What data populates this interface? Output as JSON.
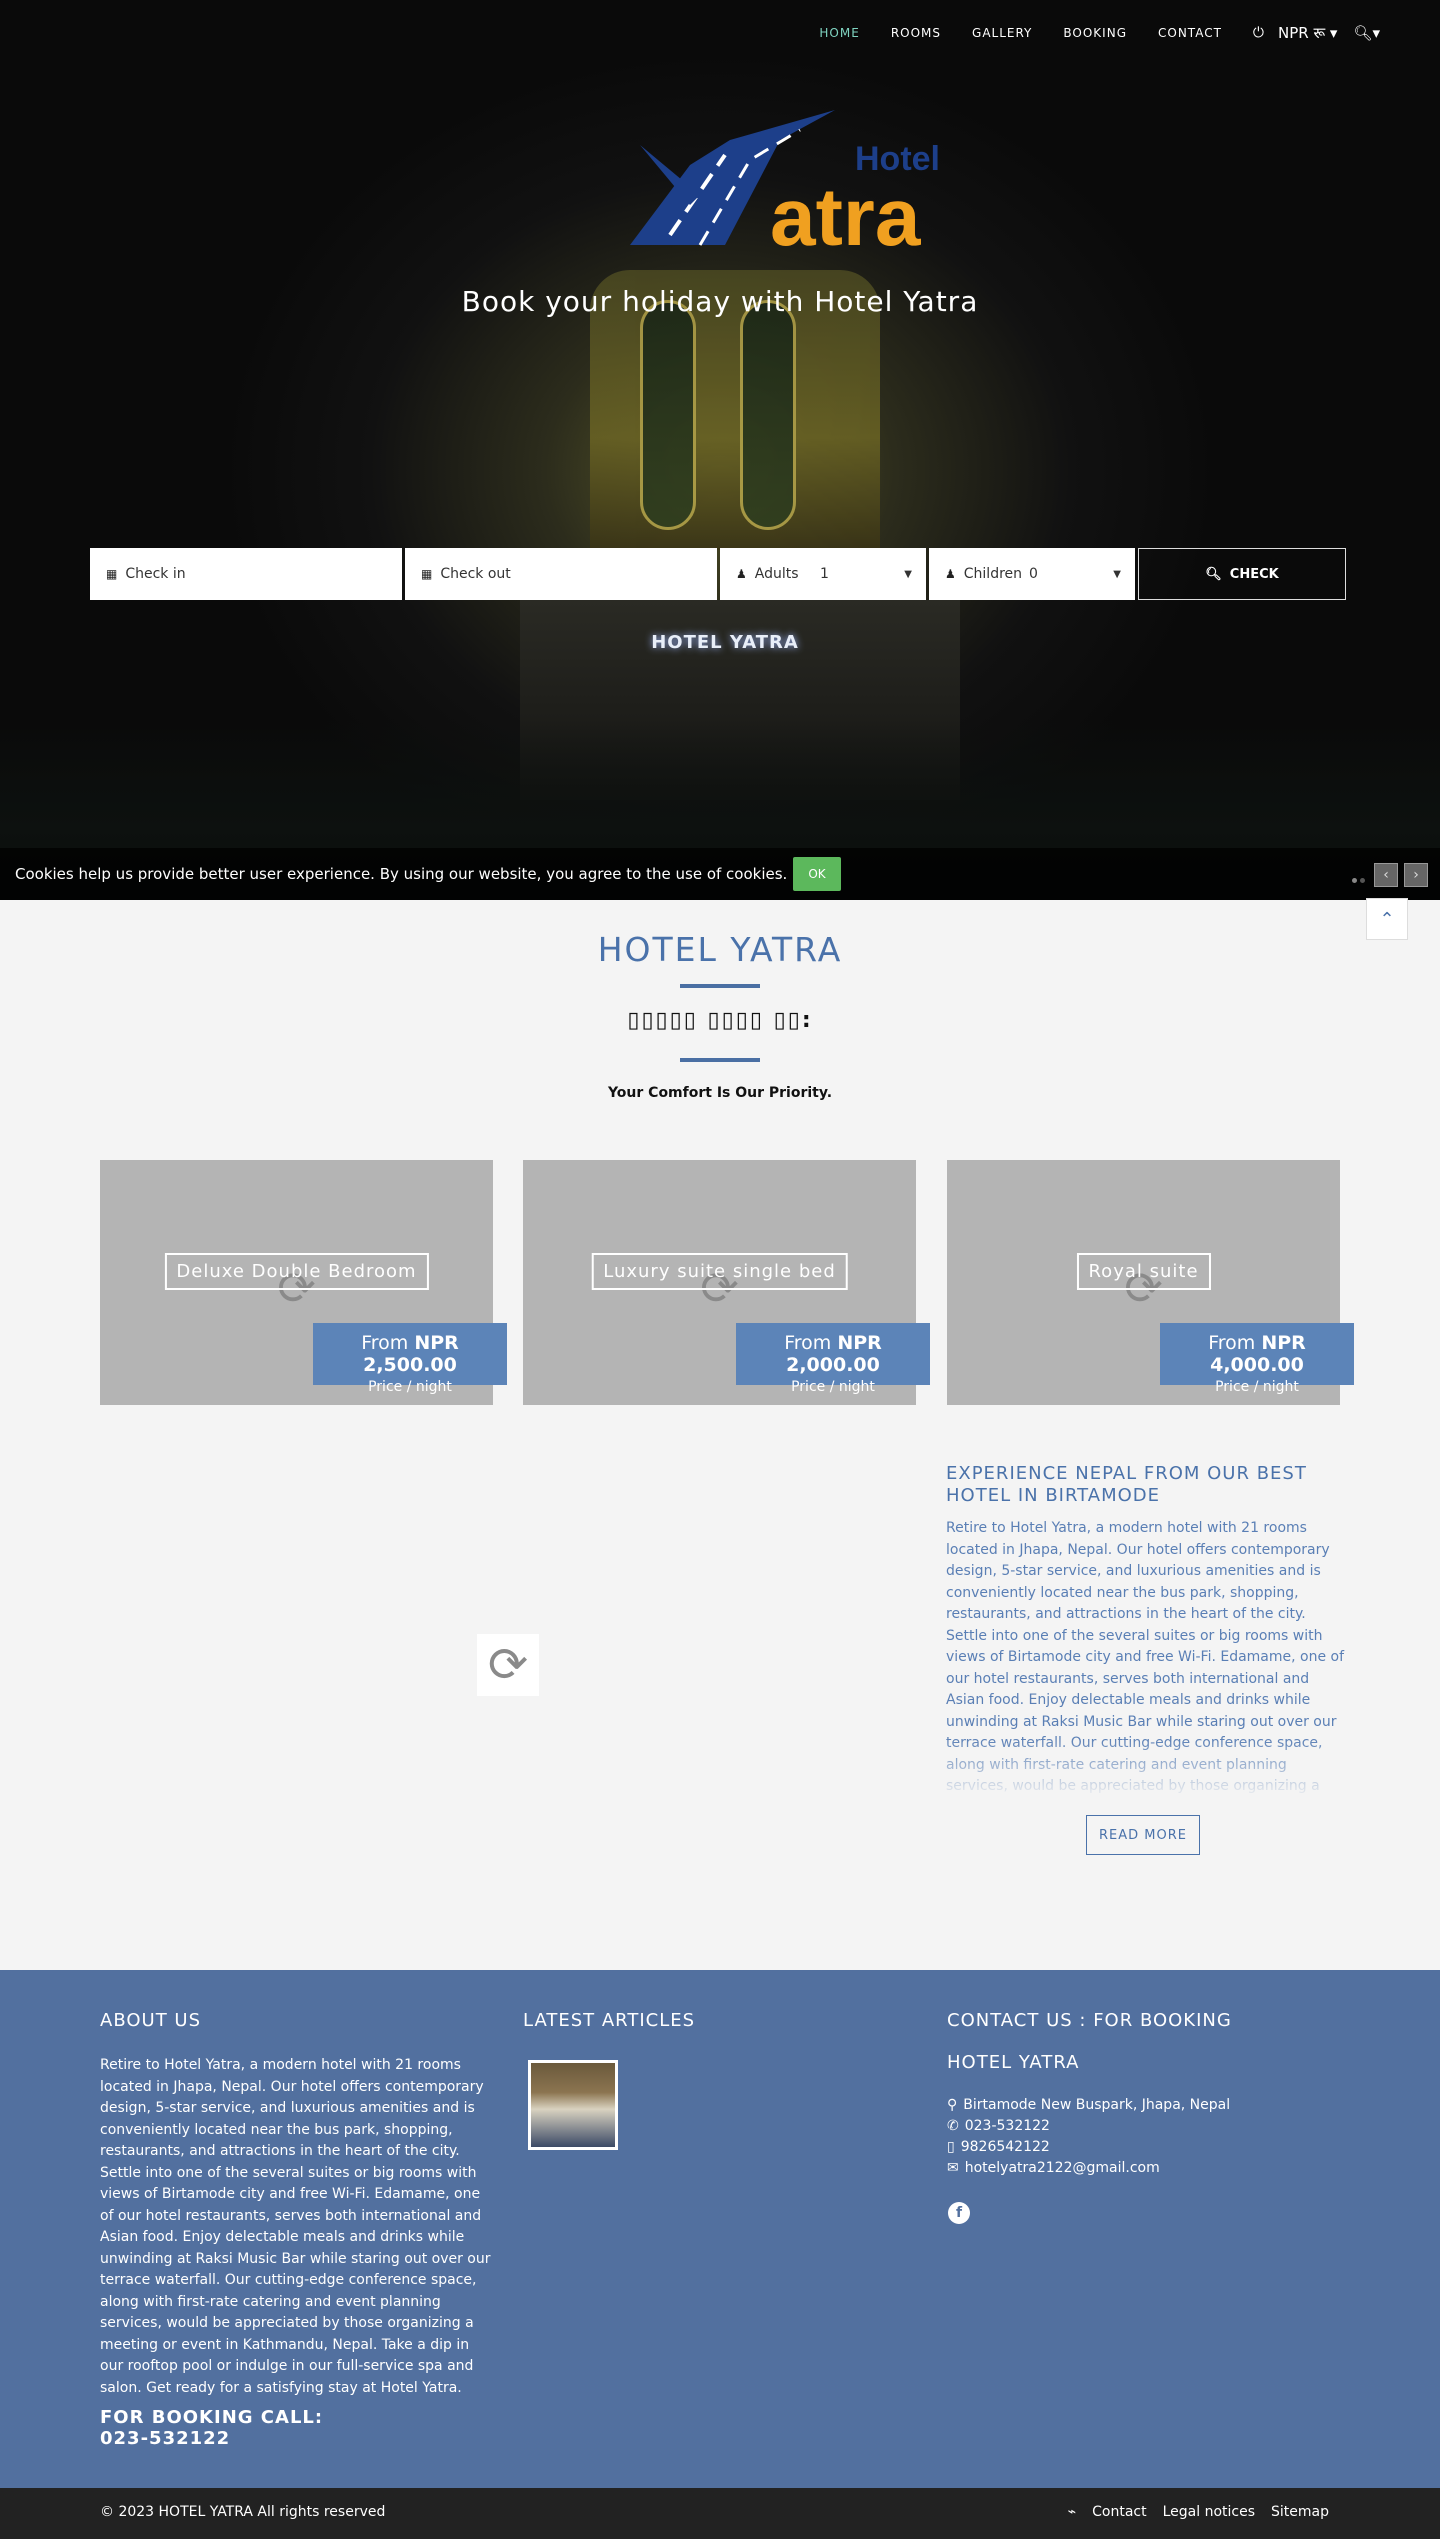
{
  "nav": {
    "items": [
      "HOME",
      "ROOMS",
      "GALLERY",
      "BOOKING",
      "CONTACT"
    ],
    "currency": "NPR रू",
    "power_icon": "power-icon",
    "search_icon": "search-icon"
  },
  "hero": {
    "logo_hotel": "Hotel",
    "logo_name": "atra",
    "logo_y": "Y",
    "tagline": "Book your holiday with Hotel Yatra",
    "sign_text": "HOTEL YATRA"
  },
  "booking": {
    "checkin_placeholder": "Check in",
    "checkout_placeholder": "Check out",
    "adults_label": "Adults",
    "adults_value": "1",
    "children_label": "Children",
    "children_value": "0",
    "check_button": "CHECK"
  },
  "cookie": {
    "text": "Cookies help us provide better user experience. By using our website, you agree to the use of cookies.",
    "ok": "OK"
  },
  "intro": {
    "title": "HOTEL YATRA",
    "subtitle": "▯▯▯▯▯ ▯▯▯▯ ▯▯:",
    "priority": "Your Comfort Is Our Priority."
  },
  "rooms": [
    {
      "name": "Deluxe Double Bedroom",
      "from": "From",
      "price": "NPR 2,500.00",
      "per": "Price / night"
    },
    {
      "name": "Luxury suite single bed",
      "from": "From",
      "price": "NPR 2,000.00",
      "per": "Price / night"
    },
    {
      "name": "Royal suite",
      "from": "From",
      "price": "NPR 4,000.00",
      "per": "Price / night"
    }
  ],
  "experience": {
    "title": "EXPERIENCE NEPAL FROM OUR BEST HOTEL IN BIRTAMODE",
    "body": "Retire to Hotel Yatra, a modern hotel with 21 rooms located in Jhapa, Nepal. Our hotel offers contemporary design, 5-star service, and luxurious amenities and is conveniently located near the bus park, shopping, restaurants, and attractions in the heart of the city. Settle into one of the several suites or big rooms with views of Birtamode city and free Wi-Fi. Edamame, one of our hotel restaurants, serves both international and Asian food. Enjoy delectable meals and drinks while unwinding at Raksi Music Bar while staring out over our terrace waterfall. Our cutting-edge conference space, along with first-rate catering and event planning services, would be appreciated by those organizing a",
    "read_more": "READ MORE"
  },
  "footer": {
    "about_title": "ABOUT US",
    "about_text": "Retire to Hotel Yatra, a modern hotel with 21 rooms located in Jhapa, Nepal. Our hotel offers contemporary design, 5-star service, and luxurious amenities and is conveniently located near the bus park, shopping, restaurants, and attractions in the heart of the city. Settle into one of the several suites or big rooms with views of Birtamode city and free Wi-Fi. Edamame, one of our hotel restaurants, serves both international and Asian food. Enjoy delectable meals and drinks while unwinding at Raksi Music Bar while staring out over our terrace waterfall. Our cutting-edge conference space, along with first-rate catering and event planning services, would be appreciated by those organizing a meeting or event in Kathmandu, Nepal. Take a dip in our rooftop pool or indulge in our full-service spa and salon. Get ready for a satisfying stay at Hotel Yatra.",
    "call_label": "FOR BOOKING CALL:",
    "call_number": "023-532122",
    "articles_title": "LATEST ARTICLES",
    "contact_title": "CONTACT US : FOR BOOKING",
    "contact_hotel": "HOTEL YATRA",
    "address": "Birtamode New Buspark, Jhapa, Nepal",
    "phone": "023-532122",
    "mobile": "9826542122",
    "email": "hotelyatra2122@gmail.com"
  },
  "bottom": {
    "copyright": "© 2023 HOTEL YATRA All rights reserved",
    "links": [
      "Contact",
      "Legal notices",
      "Sitemap"
    ]
  },
  "colors": {
    "accent": "#4a72aa",
    "footer_bg": "#52709f",
    "nav_active": "#7fd3c0",
    "cookie_ok": "#5cb85c",
    "logo_blue": "#1d3f8a",
    "logo_orange": "#f0a020"
  }
}
